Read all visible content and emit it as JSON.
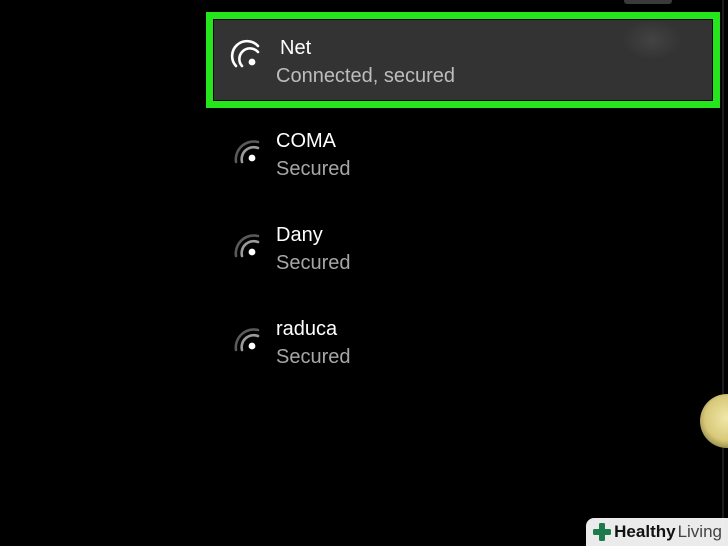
{
  "wifi_panel": {
    "networks": [
      {
        "name": "Net",
        "status": "Connected, secured",
        "highlighted": true,
        "icon": "wifi-icon"
      },
      {
        "name": "COMA",
        "status": "Secured",
        "highlighted": false,
        "icon": "wifi-icon"
      },
      {
        "name": "Dany",
        "status": "Secured",
        "highlighted": false,
        "icon": "wifi-icon"
      },
      {
        "name": "raduca",
        "status": "Secured",
        "highlighted": false,
        "icon": "wifi-icon"
      }
    ]
  },
  "watermark": {
    "brand_bold": "Healthy",
    "brand_light": "Living",
    "icon": "cross-icon"
  },
  "colors": {
    "background": "#000000",
    "selected_row": "#333333",
    "highlight_outline": "#25e61d",
    "primary_text": "#ffffff",
    "secondary_text": "#a6a6a6"
  }
}
